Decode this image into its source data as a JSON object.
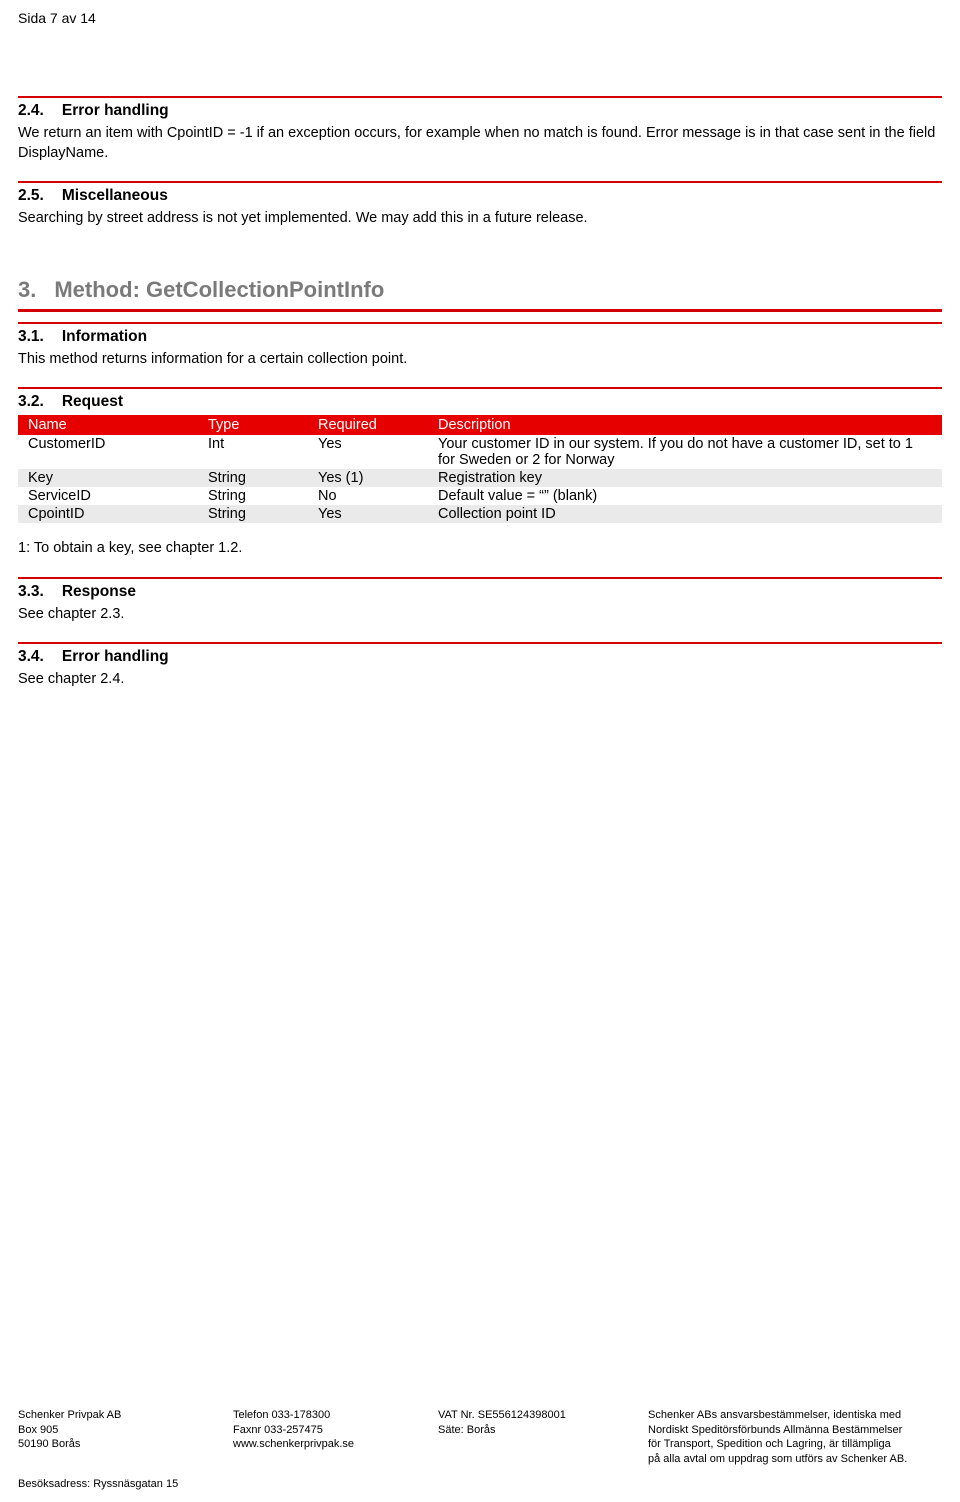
{
  "page_header": "Sida 7 av 14",
  "sections": {
    "s24": {
      "num": "2.4.",
      "title": "Error handling",
      "text": "We return an item with CpointID = -1 if an exception occurs, for example when no match is found. Error message is in that case sent in the field DisplayName."
    },
    "s25": {
      "num": "2.5.",
      "title": "Miscellaneous",
      "text": "Searching by street address is not yet implemented. We may add this in a future release."
    },
    "h3": {
      "num": "3.",
      "title": "Method: GetCollectionPointInfo"
    },
    "s31": {
      "num": "3.1.",
      "title": "Information",
      "text": "This method returns information for a certain collection point."
    },
    "s32": {
      "num": "3.2.",
      "title": "Request"
    },
    "s33": {
      "num": "3.3.",
      "title": "Response",
      "text": "See chapter 2.3."
    },
    "s34": {
      "num": "3.4.",
      "title": "Error handling",
      "text": "See chapter 2.4."
    }
  },
  "request_table": {
    "headers": {
      "name": "Name",
      "type": "Type",
      "required": "Required",
      "desc": "Description"
    },
    "rows": [
      {
        "name": "CustomerID",
        "type": "Int",
        "required": "Yes",
        "desc": "Your customer ID in our system. If you do not have a customer ID, set to 1 for Sweden or 2 for Norway"
      },
      {
        "name": "Key",
        "type": "String",
        "required": "Yes (1)",
        "desc": "Registration key"
      },
      {
        "name": "ServiceID",
        "type": "String",
        "required": "No",
        "desc": "Default value = “” (blank)"
      },
      {
        "name": "CpointID",
        "type": "String",
        "required": "Yes",
        "desc": "Collection point ID"
      }
    ],
    "footnote": "1: To obtain a key, see chapter 1.2."
  },
  "footer": {
    "col1": {
      "l1": "Schenker Privpak AB",
      "l2": "Box 905",
      "l3": "50190 Borås"
    },
    "col2": {
      "l1": "Telefon 033-178300",
      "l2": "Faxnr 033-257475",
      "l3": "www.schenkerprivpak.se"
    },
    "col3": {
      "l1": "VAT Nr. SE556124398001",
      "l2": "Säte: Borås"
    },
    "col4": {
      "l1": "Schenker ABs ansvarsbestämmelser, identiska med",
      "l2": "Nordiskt Speditörsförbunds Allmänna Bestämmelser",
      "l3": "för Transport, Spedition och Lagring, är tillämpliga",
      "l4": "på alla avtal om uppdrag som utförs av Schenker AB."
    },
    "visit": "Besöksadress: Ryssnäsgatan 15"
  }
}
